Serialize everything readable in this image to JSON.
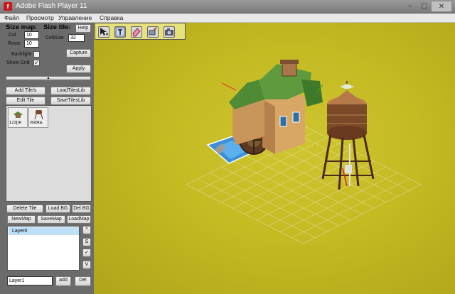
{
  "window": {
    "title": "Adobe Flash Player 11",
    "close_label": "✕",
    "min_label": "–",
    "max_label": "▢"
  },
  "menu": {
    "items": [
      "Файл",
      "Просмотр",
      "Управление",
      "Справка"
    ]
  },
  "left_panel": {
    "size_map_label": "Size map:",
    "size_tile_label": "Size tile:",
    "help_label": "Help",
    "col_label": "Col",
    "col_value": "10",
    "rows_label": "Rows",
    "rows_value": "10",
    "cellsize_label": "CellSize",
    "cellsize_value": "32",
    "backlight_label": "Backlight",
    "backlight_checked": false,
    "show_grid_label": "Show Grid",
    "show_grid_checked": true,
    "capture_label": "Capture",
    "apply_label": "Apply",
    "divider_glyph": "▲",
    "add_tiles_label": "Add Tile/s",
    "load_tiles_lib_label": "LoadTilesLib",
    "edit_tile_label": "Edit Tile",
    "save_tiles_lib_label": "SaveTilesLib",
    "tiles": [
      {
        "name": "123[re"
      },
      {
        "name": "visbka."
      }
    ],
    "delete_tile_label": "Delete Tile",
    "load_bg_label": "Load BG",
    "del_bg_label": "Del BG",
    "new_map_label": "NewMap",
    "save_map_label": "SaveMap",
    "load_map_label": "LoadMap",
    "layers": [
      {
        "name": "Layer0"
      }
    ],
    "layer_up_label": "^",
    "layer_s_label": "S",
    "layer_visible_label": "✓",
    "layer_v_label": "V",
    "new_layer_value": "Layer1",
    "add_layer_label": "add",
    "del_layer_label": "Del"
  },
  "toolbar": {
    "tools": [
      {
        "icon": "select-move-icon"
      },
      {
        "icon": "text-icon"
      },
      {
        "icon": "eraser-icon"
      },
      {
        "icon": "brush-icon"
      },
      {
        "icon": "camera-icon"
      }
    ]
  },
  "colors": {
    "canvas": "#c4ba22",
    "panel": "#6b6b6b",
    "layer_selected": "#bde0f7"
  }
}
